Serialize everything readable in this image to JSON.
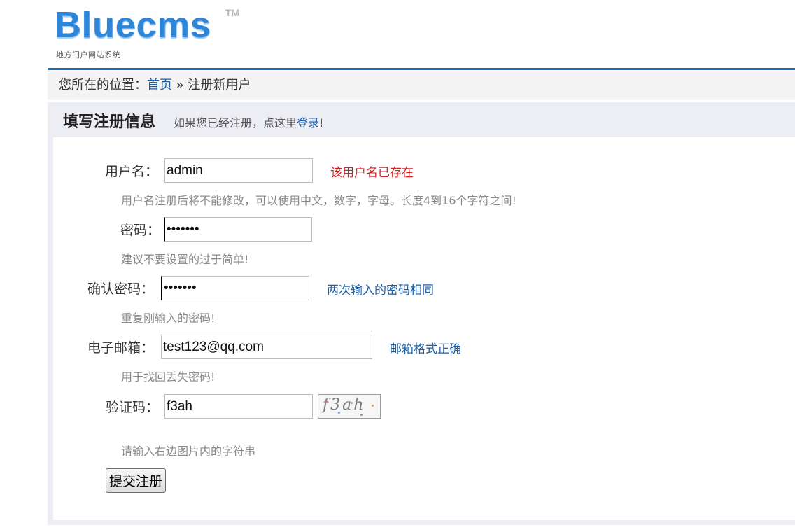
{
  "logo": {
    "brand": "Bluecms",
    "trademark": "TM",
    "subtitle": "地方门户网站系统"
  },
  "breadcrumb": {
    "prefix": "您所在的位置：",
    "home": "首页",
    "separator": " » ",
    "current": "注册新用户"
  },
  "panel": {
    "title": "填写注册信息",
    "hint_text": "如果您已经注册，点这里",
    "login_link": "登录",
    "hint_suffix": "!"
  },
  "form": {
    "username": {
      "label": "用户名：",
      "value": "admin",
      "message": "该用户名已存在",
      "tip": "用户名注册后将不能修改，可以使用中文，数字，字母。长度4到16个字符之间!"
    },
    "password": {
      "label": "密码：",
      "value": "•••••••",
      "tip": "建议不要设置的过于简单!"
    },
    "confirm_password": {
      "label": "确认密码：",
      "value": "•••••••",
      "message": "两次输入的密码相同",
      "tip": "重复刚输入的密码!"
    },
    "email": {
      "label": "电子邮箱：",
      "value": "test123@qq.com",
      "message": "邮箱格式正确",
      "tip": "用于找回丢失密码!"
    },
    "captcha": {
      "label": "验证码：",
      "value": "f3ah",
      "image_text": "f3ah",
      "tip": "请输入右边图片内的字符串"
    },
    "submit_label": "提交注册"
  },
  "colors": {
    "accent": "#1a6fb8",
    "link": "#1a5ea8",
    "error": "#d42020",
    "panel_bg": "#ededf4"
  }
}
